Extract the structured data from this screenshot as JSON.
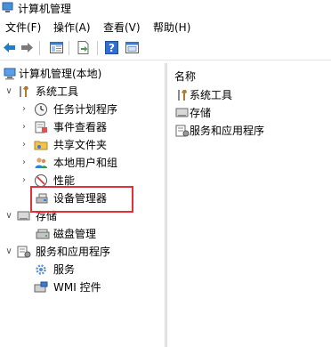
{
  "window": {
    "title": "计算机管理"
  },
  "menu": {
    "file": "文件(F)",
    "action": "操作(A)",
    "view": "查看(V)",
    "help": "帮助(H)"
  },
  "toolbar": {
    "icons": [
      "back-arrow-icon",
      "forward-arrow-icon",
      "show-hide-tree-icon",
      "export-list-icon",
      "help-icon",
      "properties-icon"
    ]
  },
  "tree": {
    "root": "计算机管理(本地)",
    "system_tools": "系统工具",
    "task_scheduler": "任务计划程序",
    "event_viewer": "事件查看器",
    "shared_folders": "共享文件夹",
    "local_users": "本地用户和组",
    "performance": "性能",
    "device_manager": "设备管理器",
    "storage": "存储",
    "disk_management": "磁盘管理",
    "services_apps": "服务和应用程序",
    "services": "服务",
    "wmi": "WMI 控件"
  },
  "list": {
    "header": "名称",
    "items": [
      "系统工具",
      "存储",
      "服务和应用程序"
    ]
  },
  "colors": {
    "highlight_border": "#e0313b",
    "accent_blue": "#1e7bd6"
  }
}
